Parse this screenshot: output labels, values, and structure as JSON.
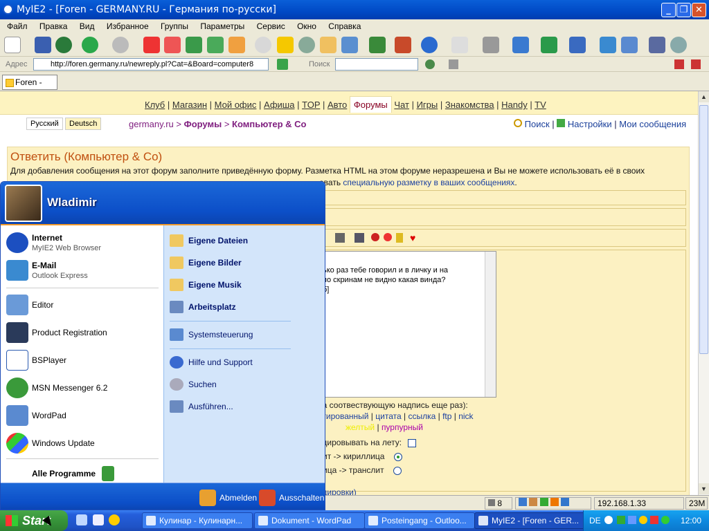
{
  "window": {
    "title": "MyIE2 - [Foren - GERMANY.RU - Германия по-русски]",
    "minimize": "_",
    "maximize": "❐",
    "close": "✕"
  },
  "menu": [
    "Файл",
    "Правка",
    "Вид",
    "Избранное",
    "Группы",
    "Параметры",
    "Сервис",
    "Окно",
    "Справка"
  ],
  "address": {
    "label": "Адрес",
    "url": "http://foren.germany.ru/newreply.pl?Cat=&Board=computer8",
    "search_label": "Поиск"
  },
  "tab": {
    "label": "Foren - GE..."
  },
  "site": {
    "topnav": [
      "Клуб",
      "Магазин",
      "Мой офис",
      "Афиша",
      "TOP",
      "Авто",
      "Форумы",
      "Чат",
      "Игры",
      "Знакомства",
      "Handy",
      "TV"
    ],
    "topnav_active": "Форумы",
    "lang_ru": "Русский",
    "lang_de": "Deutsch",
    "breadcrumb_site": "germany.ru",
    "breadcrumb_sep1": " > ",
    "breadcrumb_forums": "Форумы",
    "breadcrumb_sep2": " > ",
    "breadcrumb_board": "Компьютер & Co",
    "search": "Поиск",
    "settings": "Настройки",
    "messages": "Мои сообщения",
    "sep": " | "
  },
  "form": {
    "title": "Ответить (Компьютер & Co)",
    "desc_line1": "Для добавления сообщения на этот форум заполните приведённую форму. Разметка HTML на этом форуме неразрешена и Вы не можете использовать её в своих",
    "desc_tail": "овать",
    "desc_link": "специальную разметку в ваших сообщениях",
    "message_text": "ько раз тебе говорил и в личку и на\n по скринам не видно какая винда?\nб]",
    "hint_line": "на соотвествующую надпись еще раз):",
    "markup_links": [
      "атированный",
      "цитата",
      "ссылка",
      "ftp",
      "nick"
    ],
    "color_links": [
      "желтый",
      "пурпурный"
    ],
    "encode_label": "одировывать на лету:",
    "translit1": "лит -> кириллица",
    "translit2": "лица -> транслит",
    "bottom_link": "одировки)"
  },
  "status": {
    "count": "8",
    "ip": "192.168.1.33",
    "mem": "23M"
  },
  "startmenu": {
    "user": "Wladimir",
    "pinned": [
      {
        "title": "Internet",
        "sub": "MyIE2 Web Browser"
      },
      {
        "title": "E-Mail",
        "sub": "Outlook Express"
      }
    ],
    "recent": [
      "Editor",
      "Product Registration",
      "BSPlayer",
      "MSN Messenger 6.2",
      "WordPad",
      "Windows Update"
    ],
    "all_programs": "Alle Programme",
    "places": [
      "Eigene Dateien",
      "Eigene Bilder",
      "Eigene Musik",
      "Arbeitsplatz"
    ],
    "control": "Systemsteuerung",
    "help": "Hilfe und Support",
    "search": "Suchen",
    "run": "Ausführen...",
    "logoff": "Abmelden",
    "shutdown": "Ausschalten"
  },
  "taskbar": {
    "start": "Start",
    "tasks": [
      {
        "label": "Кулинар - Кулинарн..."
      },
      {
        "label": "Dokument - WordPad"
      },
      {
        "label": "Posteingang - Outloo..."
      },
      {
        "label": "MyIE2 - [Foren - GER..."
      }
    ],
    "lang": "DE",
    "clock": "12:00"
  }
}
